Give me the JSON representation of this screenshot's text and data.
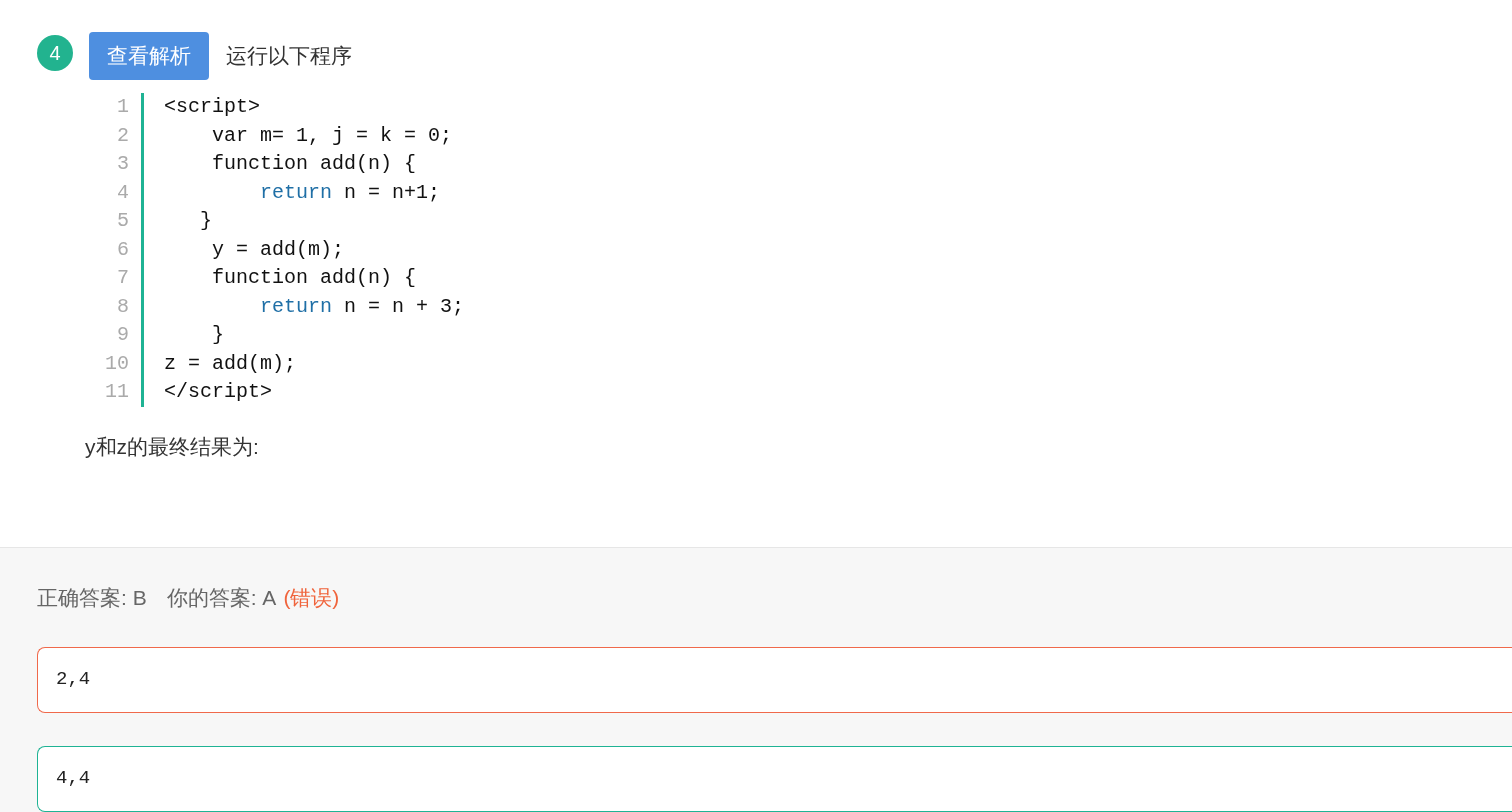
{
  "question": {
    "number": "4",
    "analysis_button": "查看解析",
    "title": "运行以下程序"
  },
  "code": {
    "lines": [
      {
        "number": "1",
        "tokens": [
          {
            "kind": "plain",
            "text": "<script>"
          }
        ]
      },
      {
        "number": "2",
        "tokens": [
          {
            "kind": "plain",
            "text": "    var m= 1, j = k = 0;"
          }
        ]
      },
      {
        "number": "3",
        "tokens": [
          {
            "kind": "plain",
            "text": "    function add(n) {"
          }
        ]
      },
      {
        "number": "4",
        "tokens": [
          {
            "kind": "keyword",
            "text": "        return"
          },
          {
            "kind": "plain",
            "text": " n = n+1;"
          }
        ]
      },
      {
        "number": "5",
        "tokens": [
          {
            "kind": "plain",
            "text": "   }"
          }
        ]
      },
      {
        "number": "6",
        "tokens": [
          {
            "kind": "plain",
            "text": "    y = add(m);"
          }
        ]
      },
      {
        "number": "7",
        "tokens": [
          {
            "kind": "plain",
            "text": "    function add(n) {"
          }
        ]
      },
      {
        "number": "8",
        "tokens": [
          {
            "kind": "keyword",
            "text": "        return"
          },
          {
            "kind": "plain",
            "text": " n = n + 3;"
          }
        ]
      },
      {
        "number": "9",
        "tokens": [
          {
            "kind": "plain",
            "text": "    }"
          }
        ]
      },
      {
        "number": "10",
        "tokens": [
          {
            "kind": "plain",
            "text": "z = add(m);"
          }
        ]
      },
      {
        "number": "11",
        "tokens": [
          {
            "kind": "plain",
            "text": "</script>"
          }
        ]
      }
    ]
  },
  "prompt": "y和z的最终结果为:",
  "result": {
    "correct_answer": "正确答案: B",
    "your_answer": "你的答案: A",
    "verdict": {
      "text": "(错误)",
      "correct": false
    }
  },
  "options": [
    {
      "text": "2,4",
      "correct": false
    },
    {
      "text": "4,4",
      "correct": true
    }
  ]
}
